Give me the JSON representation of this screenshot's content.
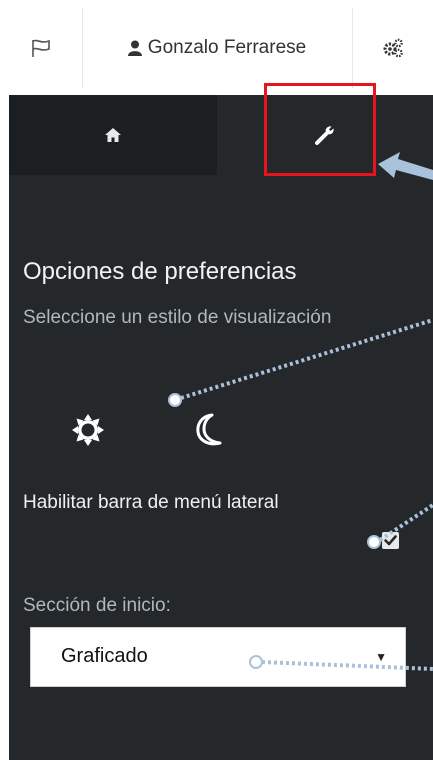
{
  "topbar": {
    "flag_icon": "flag-icon",
    "user_icon": "user-icon",
    "user_name": "Gonzalo Ferrarese",
    "gear_icon": "cogs-icon"
  },
  "tabs": [
    {
      "icon": "home-icon",
      "active": false
    },
    {
      "icon": "wrench-icon",
      "active": true
    }
  ],
  "preferences": {
    "title": "Opciones de preferencias",
    "style_label": "Seleccione un estilo de visualización",
    "style_icons": [
      "sun-icon",
      "moon-icon"
    ],
    "sidebar_label": "Habilitar barra de menú lateral",
    "sidebar_checked": true,
    "start_section_label": "Sección de inicio:",
    "start_section_value": "Graficado"
  },
  "colors": {
    "panel_bg": "#24282b",
    "highlight": "#e8141b",
    "callout": "#a9c1db"
  }
}
